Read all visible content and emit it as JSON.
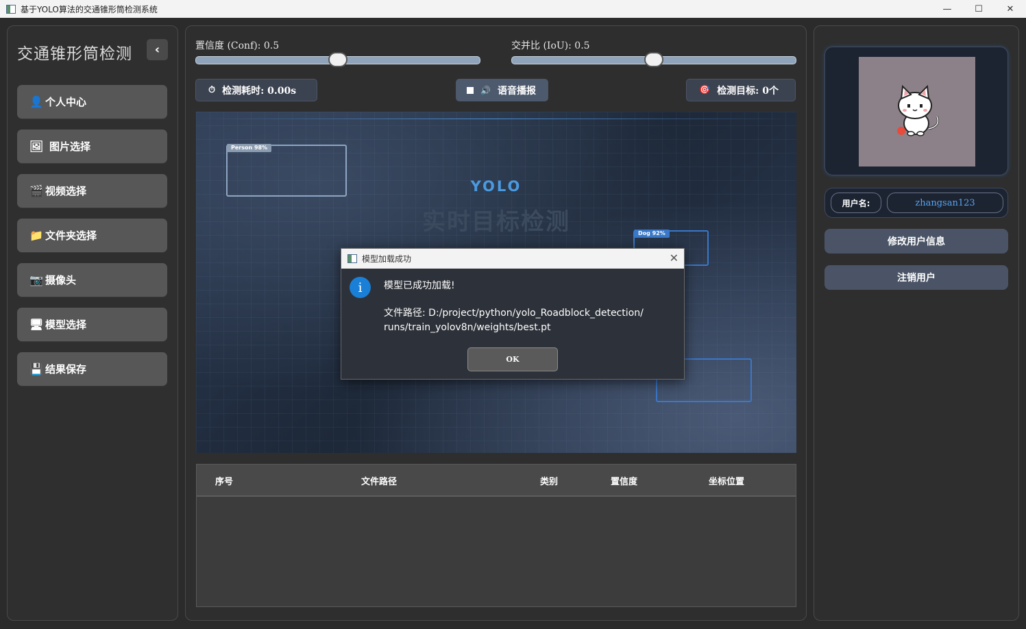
{
  "window": {
    "title": "基于YOLO算法的交通锥形筒检测系统",
    "controls": {
      "minimize": "—",
      "maximize": "☐",
      "close": "✕"
    }
  },
  "sidebar": {
    "title": "交通锥形筒检测",
    "collapse_glyph": "‹",
    "items": [
      {
        "icon": "👤",
        "label": "个人中心"
      },
      {
        "icon": "🖼",
        "label": "图片选择"
      },
      {
        "icon": "🎬",
        "label": "视频选择"
      },
      {
        "icon": "📁",
        "label": "文件夹选择"
      },
      {
        "icon": "📷",
        "label": "摄像头"
      },
      {
        "icon": "🖥",
        "label": "模型选择"
      },
      {
        "icon": "💾",
        "label": "结果保存"
      }
    ]
  },
  "controls": {
    "conf": {
      "label": "置信度 (Conf): 0.5",
      "value": 0.5
    },
    "iou": {
      "label": "交并比 (IoU): 0.5",
      "value": 0.5
    },
    "time_icon": "⏱",
    "time_label": "检测耗时: 0.00s",
    "voice_label": "语音播报",
    "voice_icon": "🔊",
    "target_icon": "🎯",
    "target_label": "检测目标: 0个"
  },
  "display": {
    "yolo": "YOLO",
    "title": "实时目标检测",
    "boxes": [
      {
        "label": "Person 98%"
      },
      {
        "label": "Dog 92%"
      }
    ]
  },
  "table": {
    "headers": [
      "序号",
      "文件路径",
      "类别",
      "置信度",
      "坐标位置"
    ]
  },
  "user": {
    "name_label": "用户名:",
    "name_value": "zhangsan123",
    "edit_button": "修改用户信息",
    "logout_button": "注销用户"
  },
  "dialog": {
    "title": "模型加载成功",
    "message": "模型已成功加载!",
    "path_line1": "文件路径: D:/project/python/yolo_Roadblock_detection/",
    "path_line2": "runs/train_yolov8n/weights/best.pt",
    "ok": "OK",
    "info_glyph": "i",
    "close_glyph": "✕"
  },
  "colors": {
    "accent": "#4a9ae0",
    "username": "#5aa5f0",
    "info_icon": "#1a7fd6"
  }
}
